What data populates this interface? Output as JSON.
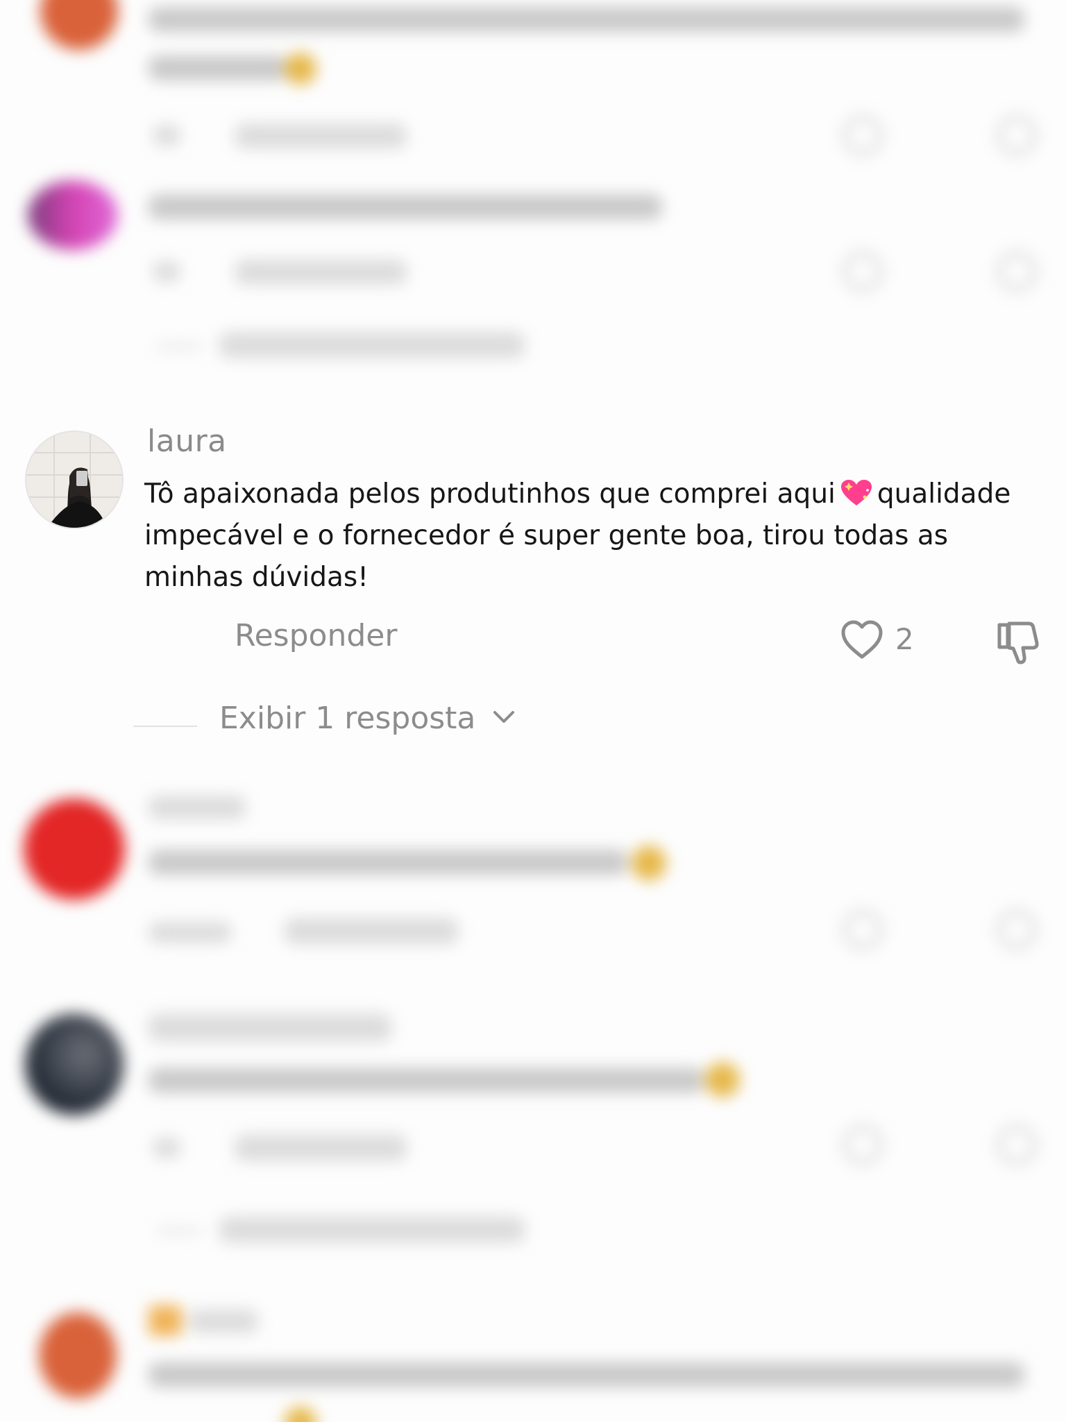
{
  "comment": {
    "username": "laura",
    "text_before_emoji": "Tô apaixonada pelos produtinhos que comprei aqui",
    "emoji": "sparkling-heart-emoji",
    "text_after_emoji": "qualidade impecável e o fornecedor é super gente boa, tirou todas as minhas dúvidas!",
    "reply_label": "Responder",
    "like_count": "2",
    "view_replies_label": "Exibir 1 resposta"
  },
  "colors": {
    "meta_text": "#8c8c8c",
    "body_text": "#161616",
    "emoji_pink": "#ff3f8e"
  },
  "icons": {
    "like": "heart-outline-icon",
    "dislike": "thumbs-down-icon",
    "expand": "chevron-down-icon"
  }
}
